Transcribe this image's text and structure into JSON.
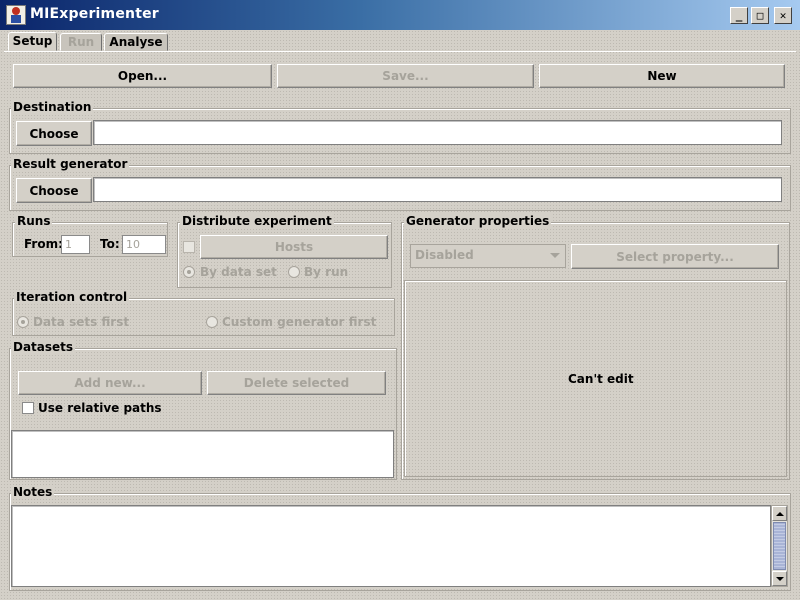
{
  "window": {
    "title": "MIExperimenter",
    "controls": {
      "minimize": "_",
      "maximize": "□",
      "close": "✕"
    }
  },
  "tabs": [
    {
      "label": "Setup",
      "state": "active"
    },
    {
      "label": "Run",
      "state": "disabled"
    },
    {
      "label": "Analyse",
      "state": "inactive"
    }
  ],
  "toolbar": {
    "open_label": "Open...",
    "save_label": "Save...",
    "new_label": "New"
  },
  "destination": {
    "title": "Destination",
    "choose_label": "Choose",
    "value": ""
  },
  "result_generator": {
    "title": "Result generator",
    "choose_label": "Choose",
    "value": ""
  },
  "runs": {
    "title": "Runs",
    "from_label": "From:",
    "from_value": "1",
    "to_label": "To:",
    "to_value": "10"
  },
  "distribute": {
    "title": "Distribute experiment",
    "hosts_label": "Hosts",
    "by_data_set": "By data set",
    "by_run": "By run"
  },
  "generator_properties": {
    "title": "Generator properties",
    "combo_value": "Disabled",
    "select_property": "Select property...",
    "cant_edit": "Can't edit"
  },
  "iteration": {
    "title": "Iteration control",
    "data_sets_first": "Data sets first",
    "custom_first": "Custom generator first"
  },
  "datasets": {
    "title": "Datasets",
    "add_new": "Add new...",
    "delete_selected": "Delete selected",
    "use_relative_paths": "Use relative paths"
  },
  "notes": {
    "title": "Notes",
    "value": ""
  },
  "colors": {
    "title_start": "#0a246a",
    "title_end": "#a6caf0",
    "window_bg": "#d4d0c8",
    "disabled_text": "#a6a39b"
  }
}
